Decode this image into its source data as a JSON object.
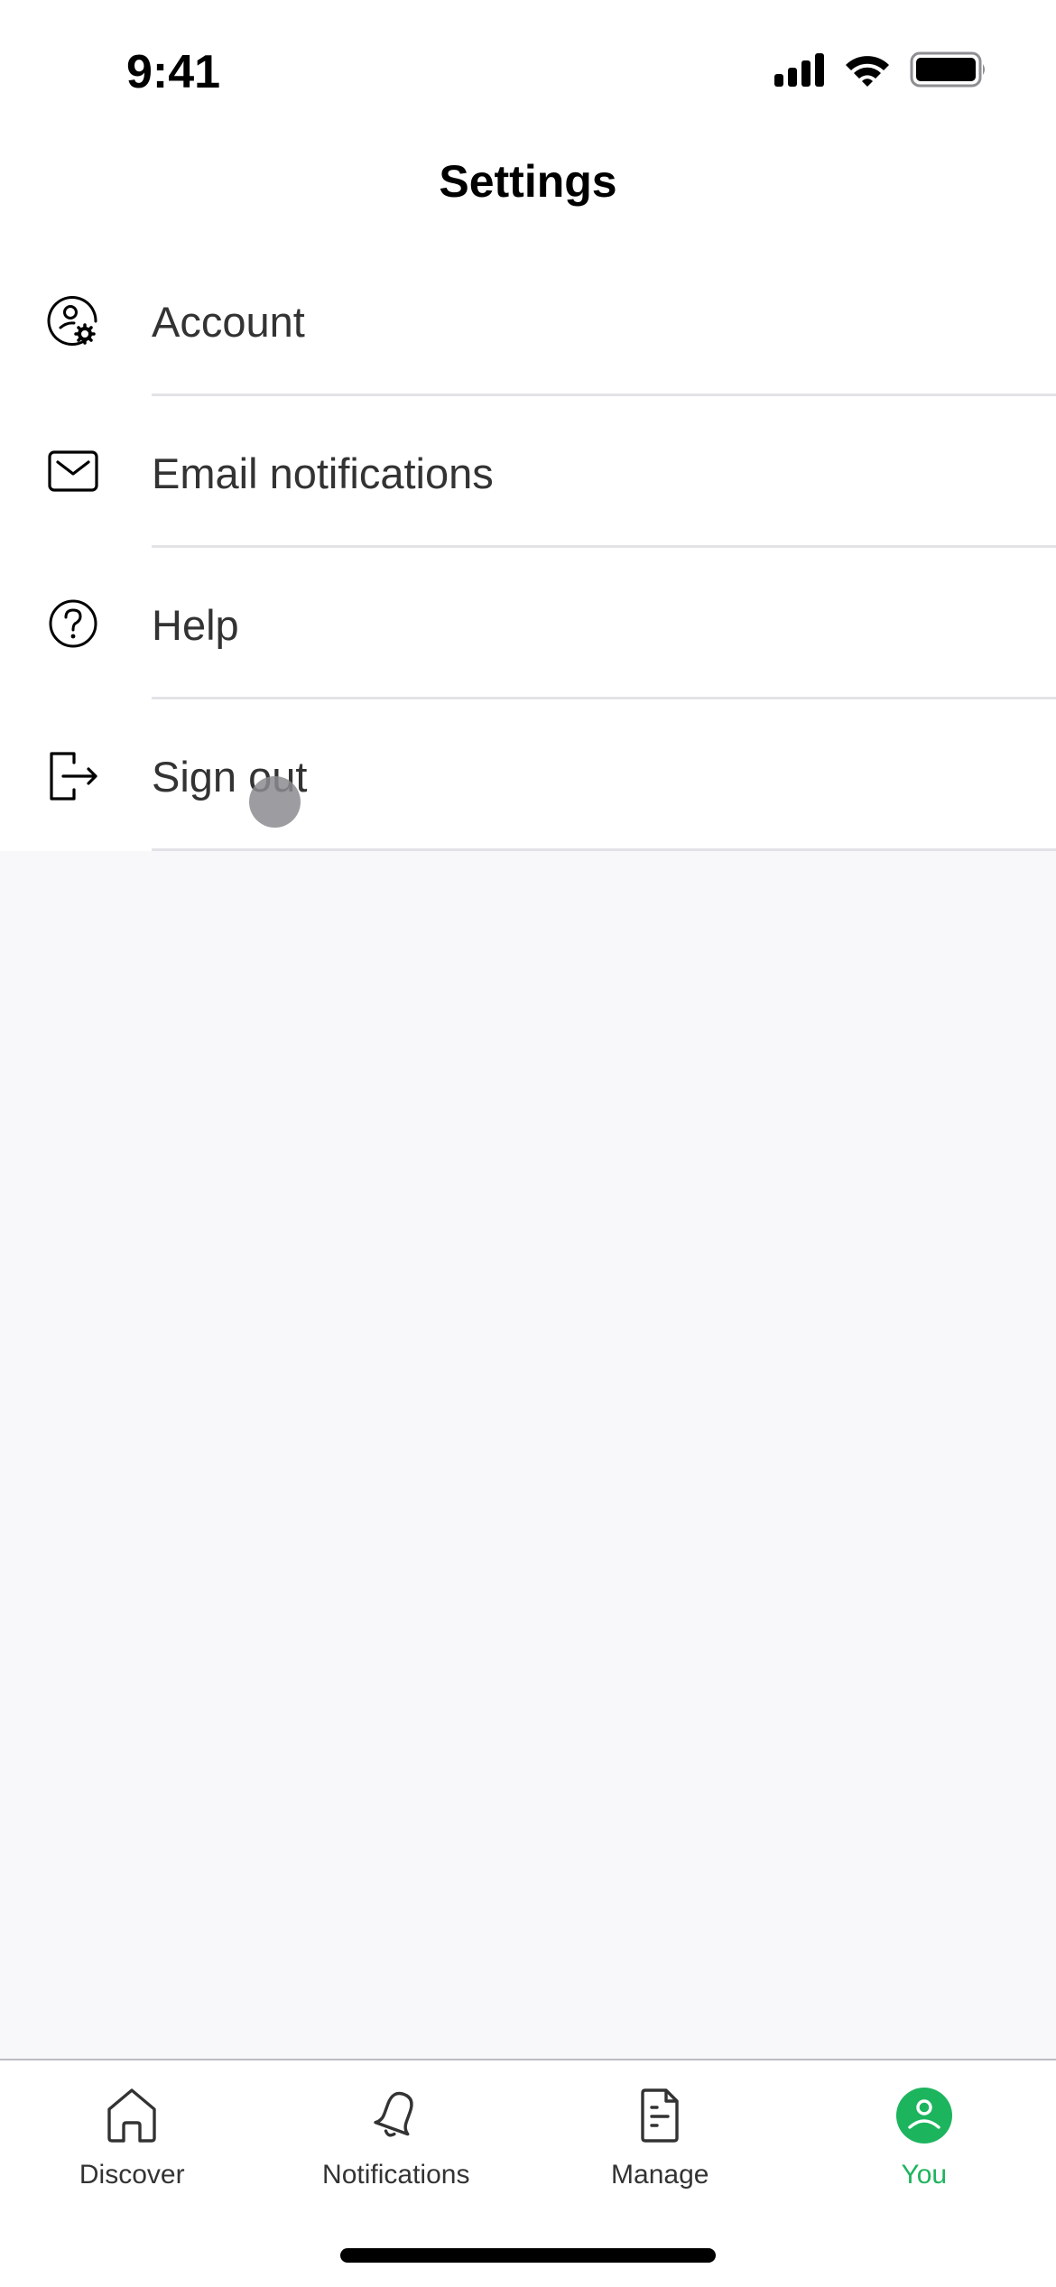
{
  "status_bar": {
    "time": "9:41",
    "icons": [
      "cellular-signal-icon",
      "wifi-icon",
      "battery-icon"
    ]
  },
  "header": {
    "title": "Settings"
  },
  "menu": {
    "items": [
      {
        "label": "Account",
        "icon": "account-settings-icon"
      },
      {
        "label": "Email notifications",
        "icon": "envelope-icon"
      },
      {
        "label": "Help",
        "icon": "question-circle-icon"
      },
      {
        "label": "Sign out",
        "icon": "sign-out-icon"
      }
    ]
  },
  "tabbar": {
    "active_color": "#1DB45E",
    "tabs": [
      {
        "label": "Discover",
        "icon": "home-icon",
        "active": false
      },
      {
        "label": "Notifications",
        "icon": "bell-icon",
        "active": false
      },
      {
        "label": "Manage",
        "icon": "document-icon",
        "active": false
      },
      {
        "label": "You",
        "icon": "profile-icon",
        "active": true
      }
    ]
  },
  "colors": {
    "background": "#F8F7FA",
    "surface": "#FFFFFF",
    "text": "#333333",
    "accent": "#1DB45E",
    "divider": "#E3E2E6"
  }
}
